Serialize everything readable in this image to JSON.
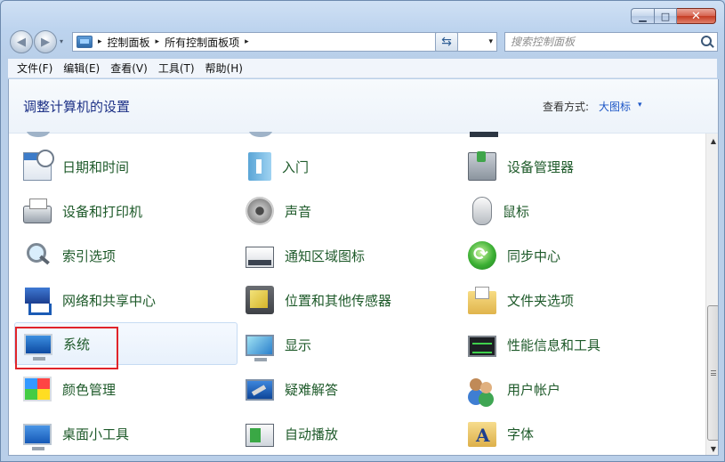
{
  "window": {
    "minimize_glyph": "▁",
    "maximize_glyph": "□",
    "close_glyph": "✕"
  },
  "nav": {
    "back_glyph": "◀",
    "forward_glyph": "▶",
    "history_glyph": "▾",
    "breadcrumb": [
      "控制面板",
      "所有控制面板项"
    ],
    "crumb_sep": "▸",
    "address_drop_glyph": "▾",
    "refresh_glyph": "⇆"
  },
  "search": {
    "placeholder": "搜索控制面板"
  },
  "menubar": [
    "文件(F)",
    "编辑(E)",
    "查看(V)",
    "工具(T)",
    "帮助(H)"
  ],
  "header": {
    "title": "调整计算机的设置",
    "view_by_label": "查看方式:",
    "view_by_value": "大图标",
    "view_by_arrow": "▾"
  },
  "items": [
    {
      "label": "日期和时间",
      "icon": "calendar-clock-icon"
    },
    {
      "label": "入门",
      "icon": "getting-started-icon"
    },
    {
      "label": "设备管理器",
      "icon": "device-manager-icon"
    },
    {
      "label": "设备和打印机",
      "icon": "printer-icon"
    },
    {
      "label": "声音",
      "icon": "speaker-icon"
    },
    {
      "label": "鼠标",
      "icon": "mouse-icon"
    },
    {
      "label": "索引选项",
      "icon": "magnifier-icon"
    },
    {
      "label": "通知区域图标",
      "icon": "notification-tray-icon"
    },
    {
      "label": "同步中心",
      "icon": "sync-icon"
    },
    {
      "label": "网络和共享中心",
      "icon": "network-icon"
    },
    {
      "label": "位置和其他传感器",
      "icon": "sensor-icon"
    },
    {
      "label": "文件夹选项",
      "icon": "folder-options-icon"
    },
    {
      "label": "系统",
      "icon": "system-monitor-icon"
    },
    {
      "label": "显示",
      "icon": "display-icon"
    },
    {
      "label": "性能信息和工具",
      "icon": "performance-icon"
    },
    {
      "label": "颜色管理",
      "icon": "color-management-icon"
    },
    {
      "label": "疑难解答",
      "icon": "troubleshooting-icon"
    },
    {
      "label": "用户帐户",
      "icon": "user-accounts-icon"
    },
    {
      "label": "桌面小工具",
      "icon": "desktop-gadgets-icon"
    },
    {
      "label": "自动播放",
      "icon": "autoplay-icon"
    },
    {
      "label": "字体",
      "icon": "fonts-icon"
    }
  ],
  "scrollbar": {
    "up_glyph": "▲",
    "down_glyph": "▼"
  },
  "colors": {
    "item_label": "#1e5a2a",
    "title": "#1e3287",
    "link": "#1e57c7",
    "highlight": "#e0242a"
  }
}
